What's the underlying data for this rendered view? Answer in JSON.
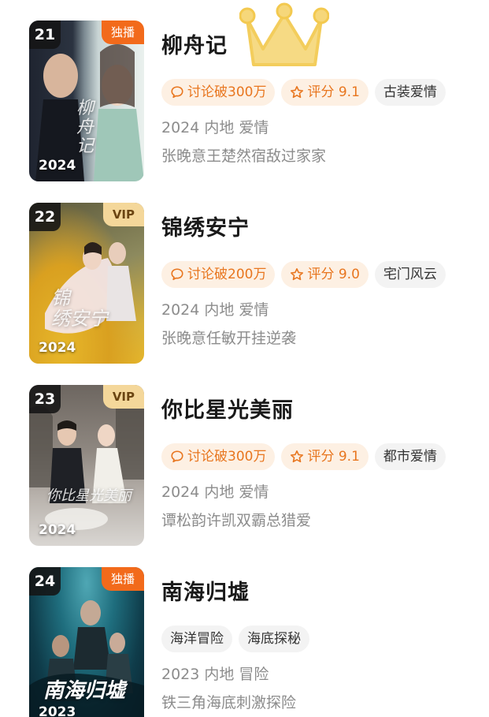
{
  "items": [
    {
      "rank": "21",
      "badge": "独播",
      "badge_type": "exclusive",
      "poster_year": "2024",
      "title": "柳舟记",
      "discussion": "讨论破300万",
      "rating": "评分 9.1",
      "genre": "古装爱情",
      "meta": "2024 内地 爱情",
      "desc": "张晚意王楚然宿敌过家家"
    },
    {
      "rank": "22",
      "badge": "VIP",
      "badge_type": "vip",
      "poster_year": "2024",
      "title": "锦绣安宁",
      "discussion": "讨论破200万",
      "rating": "评分 9.0",
      "genre": "宅门风云",
      "meta": "2024 内地 爱情",
      "desc": "张晚意任敏开挂逆袭"
    },
    {
      "rank": "23",
      "badge": "VIP",
      "badge_type": "vip",
      "poster_year": "2024",
      "title": "你比星光美丽",
      "discussion": "讨论破300万",
      "rating": "评分 9.1",
      "genre": "都市爱情",
      "meta": "2024 内地 爱情",
      "desc": "谭松韵许凯双霸总猎爱"
    },
    {
      "rank": "24",
      "badge": "独播",
      "badge_type": "exclusive",
      "poster_year": "2023",
      "title": "南海归墟",
      "tags": [
        "海洋冒险",
        "海底探秘"
      ],
      "meta": "2023 内地 冒险",
      "desc": "铁三角海底刺激探险"
    }
  ],
  "colors": {
    "accent": "#e8761f",
    "exclusive_badge": "#f26a1b",
    "vip_badge": "#f4d79a",
    "crown": "#f6d77a"
  }
}
